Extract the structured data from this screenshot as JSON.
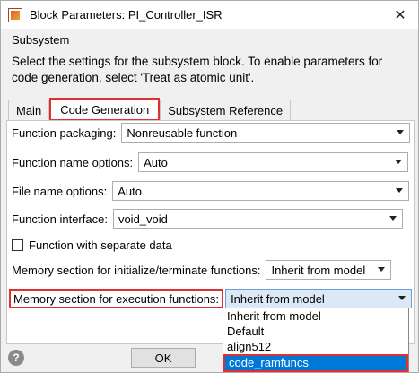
{
  "window": {
    "title": "Block Parameters: PI_Controller_ISR",
    "close_glyph": "✕"
  },
  "group_label": "Subsystem",
  "description": "Select the settings for the subsystem block. To enable parameters for code generation, select 'Treat as atomic unit'.",
  "tabs": [
    {
      "label": "Main",
      "active": false
    },
    {
      "label": "Code Generation",
      "active": true
    },
    {
      "label": "Subsystem Reference",
      "active": false
    }
  ],
  "fields": {
    "function_packaging": {
      "label": "Function packaging:",
      "value": "Nonreusable function"
    },
    "function_name_options": {
      "label": "Function name options:",
      "value": "Auto"
    },
    "file_name_options": {
      "label": "File name options:",
      "value": "Auto"
    },
    "function_interface": {
      "label": "Function interface:",
      "value": "void_void"
    },
    "separate_data": {
      "label": "Function with separate data",
      "checked": false
    },
    "memory_init_term": {
      "label": "Memory section for initialize/terminate functions:",
      "value": "Inherit from model"
    },
    "memory_exec": {
      "label": "Memory section for execution functions:",
      "value": "Inherit from model"
    }
  },
  "dropdown_options": [
    "Inherit from model",
    "Default",
    "align512",
    "code_ramfuncs",
    "..."
  ],
  "dropdown_selected_index": 3,
  "buttons": {
    "ok": "OK",
    "help": "?"
  },
  "colors": {
    "highlight": "#0078d7",
    "annotation": "#e03030"
  }
}
